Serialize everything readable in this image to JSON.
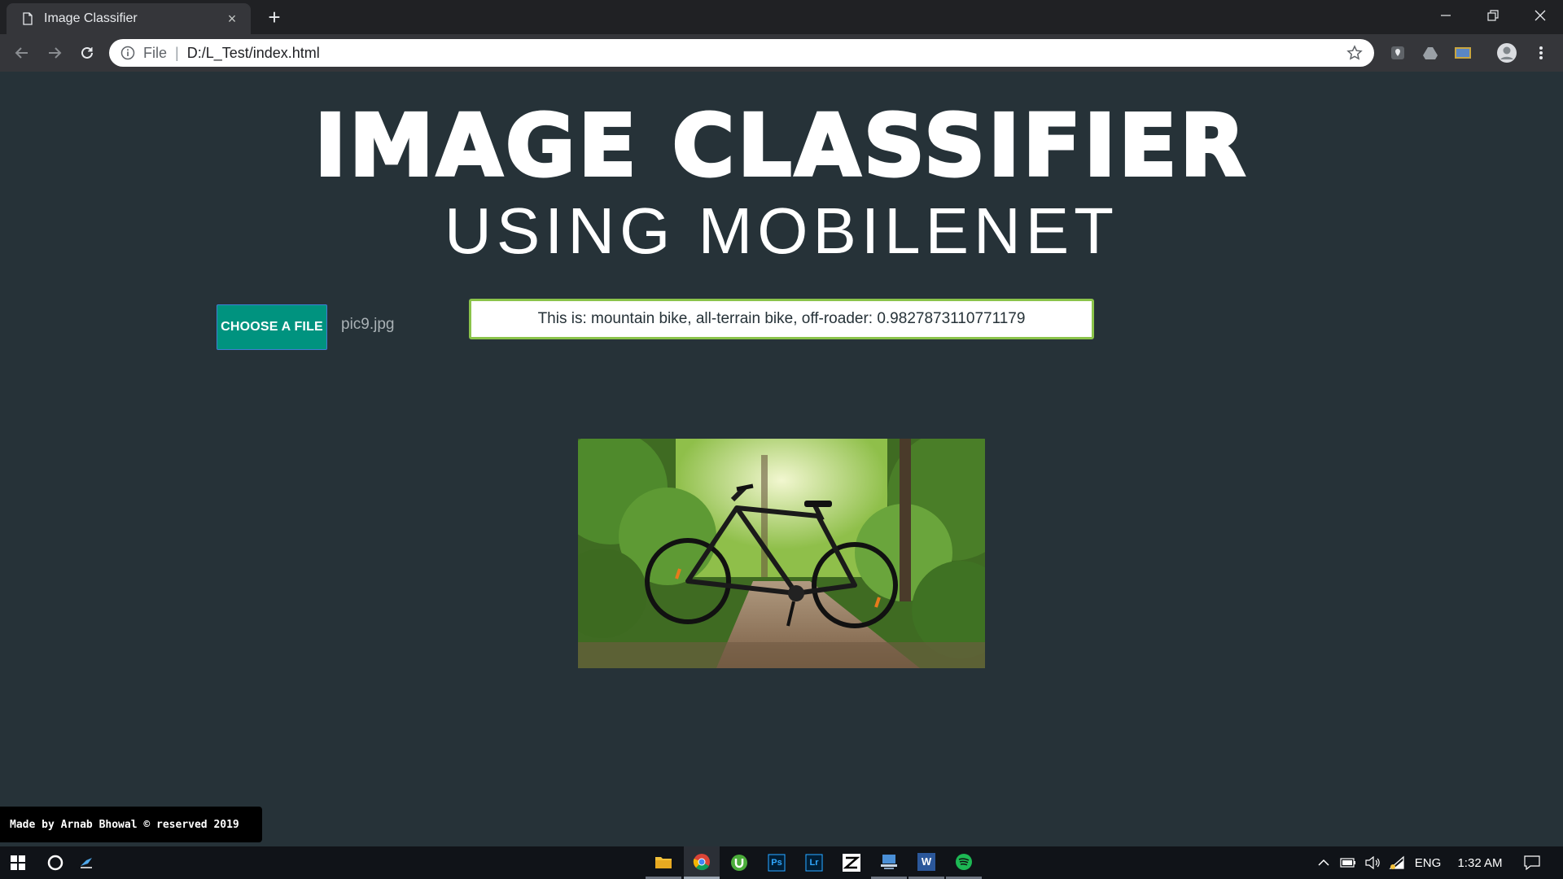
{
  "browser": {
    "tab_title": "Image Classifier",
    "new_tab_symbol": "+",
    "tab_close_symbol": "×",
    "omnibox": {
      "scheme_label": "File",
      "separator": "|",
      "url": "D:/L_Test/index.html"
    },
    "icons": [
      "back-arrow-icon",
      "forward-arrow-icon",
      "reload-icon",
      "info-icon",
      "bookmark-star-icon",
      "maps-extension-icon",
      "drive-extension-icon",
      "photo-extension-icon",
      "profile-avatar-icon",
      "menu-kebab-icon",
      "minimize-icon",
      "restore-icon",
      "close-window-icon"
    ]
  },
  "page": {
    "heading": "IMAGE CLASSIFIER",
    "subheading": "USING MOBILENET",
    "choose_file_label": "CHOOSE A FILE",
    "selected_file": "pic9.jpg",
    "result_text": "This is: mountain bike, all-terrain bike, off-roader: 0.9827873110771179",
    "footer_text": "Made by Arnab Bhowal © reserved 2019"
  },
  "taskbar": {
    "apps": [
      "file-explorer-icon",
      "chrome-icon",
      "utorrent-icon",
      "photoshop-icon",
      "lightroom-icon",
      "zeplin-icon",
      "network-app-icon",
      "word-icon",
      "spotify-icon"
    ],
    "app_letters": {
      "photoshop": "Ps",
      "lightroom": "Lr",
      "word": "W"
    },
    "language": "ENG",
    "time": "1:32 AM"
  },
  "colors": {
    "page_bg": "#263238",
    "button_bg": "#00937f",
    "result_border": "#8bc34a",
    "chrome_dark": "#202124",
    "toolbar": "#35363a"
  }
}
